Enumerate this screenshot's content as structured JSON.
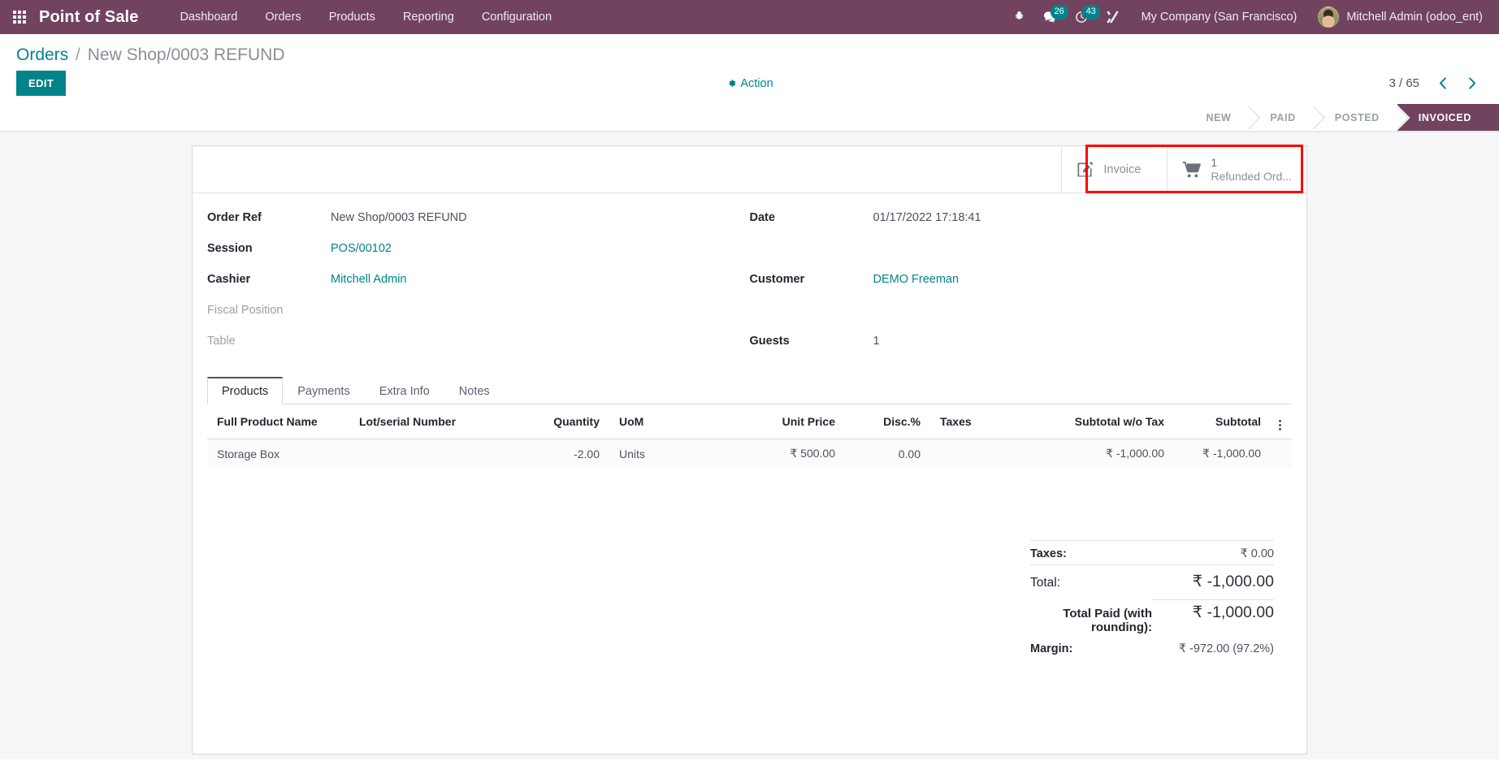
{
  "navbar": {
    "apps_icon": "apps-grid-icon",
    "brand": "Point of Sale",
    "menu": [
      {
        "label": "Dashboard"
      },
      {
        "label": "Orders"
      },
      {
        "label": "Products"
      },
      {
        "label": "Reporting"
      },
      {
        "label": "Configuration"
      }
    ],
    "icons": [
      {
        "name": "bug-icon",
        "badge": null
      },
      {
        "name": "messages-icon",
        "badge": "26"
      },
      {
        "name": "activities-clock-icon",
        "badge": "43"
      },
      {
        "name": "tools-icon",
        "badge": null
      }
    ],
    "company": "My Company (San Francisco)",
    "user": "Mitchell Admin (odoo_ent)",
    "bg_color": "#71435f",
    "badge_color": "#00848a"
  },
  "control_panel": {
    "breadcrumb_root": "Orders",
    "breadcrumb_separator": "/",
    "breadcrumb_current": "New Shop/0003 REFUND",
    "edit_button": "EDIT",
    "action_button": "Action",
    "pager_text": "3 / 65",
    "pager_prev": "‹",
    "pager_next": "›",
    "accent_color": "#00848a"
  },
  "statusbar": {
    "stages": [
      {
        "label": "NEW",
        "active": false
      },
      {
        "label": "PAID",
        "active": false
      },
      {
        "label": "POSTED",
        "active": false
      },
      {
        "label": "INVOICED",
        "active": true
      }
    ],
    "active_color": "#71435f"
  },
  "smart_buttons": {
    "highlight_color": "#ff0000",
    "invoice": {
      "icon": "pencil-square-icon",
      "label": "Invoice"
    },
    "refunded": {
      "icon": "shopping-cart-icon",
      "value": "1",
      "label": "Refunded Ord..."
    }
  },
  "form": {
    "left": [
      {
        "label": "Order Ref",
        "value": "New Shop/0003 REFUND",
        "link": false,
        "empty": false
      },
      {
        "label": "Session",
        "value": "POS/00102",
        "link": true,
        "empty": false
      },
      {
        "label": "Cashier",
        "value": "Mitchell Admin",
        "link": true,
        "empty": false
      },
      {
        "label": "Fiscal Position",
        "value": "",
        "link": false,
        "empty": true
      },
      {
        "label": "Table",
        "value": "",
        "link": false,
        "empty": true
      }
    ],
    "right": [
      {
        "label": "Date",
        "value": "01/17/2022 17:18:41",
        "link": false,
        "empty": false
      },
      {
        "label": "",
        "value": "",
        "link": false,
        "empty": true
      },
      {
        "label": "Customer",
        "value": "DEMO Freeman",
        "link": true,
        "empty": false
      },
      {
        "label": "",
        "value": "",
        "link": false,
        "empty": true
      },
      {
        "label": "Guests",
        "value": "1",
        "link": false,
        "empty": false
      }
    ]
  },
  "tabs": [
    {
      "label": "Products",
      "active": true
    },
    {
      "label": "Payments",
      "active": false
    },
    {
      "label": "Extra Info",
      "active": false
    },
    {
      "label": "Notes",
      "active": false
    }
  ],
  "lines_table": {
    "columns": [
      {
        "label": "Full Product Name",
        "align": "l"
      },
      {
        "label": "Lot/serial Number",
        "align": "l"
      },
      {
        "label": "Quantity",
        "align": "r"
      },
      {
        "label": "UoM",
        "align": "l"
      },
      {
        "label": "Unit Price",
        "align": "r"
      },
      {
        "label": "Disc.%",
        "align": "r"
      },
      {
        "label": "Taxes",
        "align": "l"
      },
      {
        "label": "Subtotal w/o Tax",
        "align": "r"
      },
      {
        "label": "Subtotal",
        "align": "r"
      }
    ],
    "optional_columns_icon": "vertical-dots-icon",
    "rows": [
      {
        "full_product_name": "Storage Box",
        "lot_serial_number": "",
        "quantity": "-2.00",
        "uom": "Units",
        "unit_price": "₹ 500.00",
        "disc_pct": "0.00",
        "taxes": "",
        "subtotal_wo_tax": "₹ -1,000.00",
        "subtotal": "₹ -1,000.00"
      }
    ]
  },
  "totals": {
    "taxes_label": "Taxes:",
    "taxes_value": "₹ 0.00",
    "total_label": "Total:",
    "total_value": "₹ -1,000.00",
    "total_paid_label": "Total Paid (with rounding):",
    "total_paid_value": "₹ -1,000.00",
    "margin_label": "Margin:",
    "margin_value": "₹ -972.00 (97.2%)"
  }
}
